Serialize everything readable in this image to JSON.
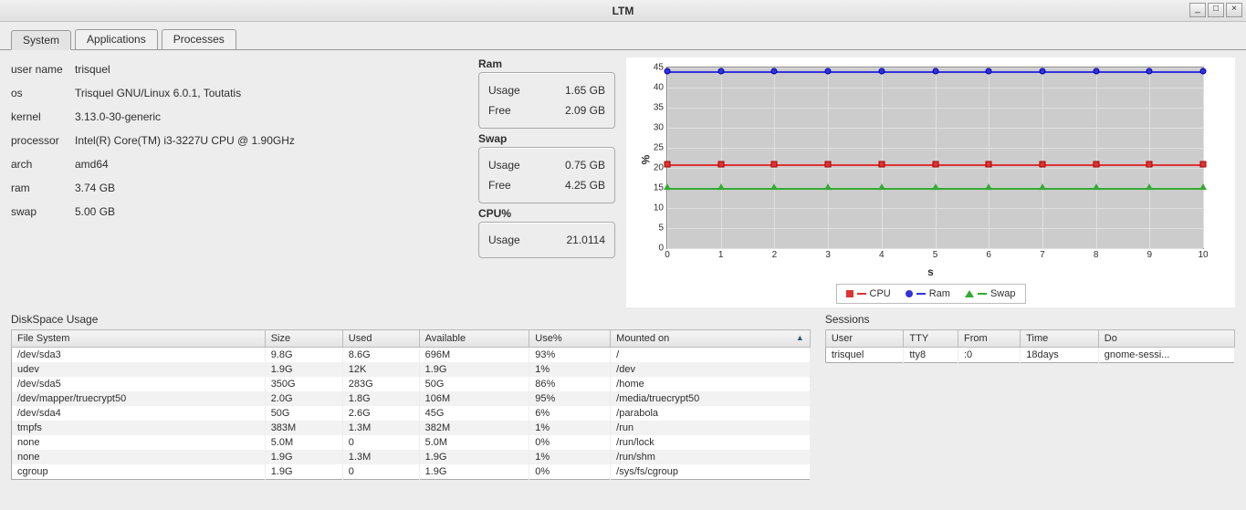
{
  "window": {
    "title": "LTM"
  },
  "tabs": [
    {
      "label": "System",
      "active": true
    },
    {
      "label": "Applications",
      "active": false
    },
    {
      "label": "Processes",
      "active": false
    }
  ],
  "sysinfo": [
    {
      "label": "user name",
      "value": "trisquel"
    },
    {
      "label": "os",
      "value": "Trisquel GNU/Linux 6.0.1, Toutatis"
    },
    {
      "label": "kernel",
      "value": "3.13.0-30-generic"
    },
    {
      "label": "processor",
      "value": "Intel(R) Core(TM) i3-3227U CPU @ 1.90GHz"
    },
    {
      "label": "arch",
      "value": "amd64"
    },
    {
      "label": "ram",
      "value": "3.74 GB"
    },
    {
      "label": "swap",
      "value": "5.00 GB"
    }
  ],
  "metrics": {
    "ram": {
      "title": "Ram",
      "usage_label": "Usage",
      "usage": "1.65 GB",
      "free_label": "Free",
      "free": "2.09 GB"
    },
    "swap": {
      "title": "Swap",
      "usage_label": "Usage",
      "usage": "0.75 GB",
      "free_label": "Free",
      "free": "4.25 GB"
    },
    "cpu": {
      "title": "CPU%",
      "usage_label": "Usage",
      "usage": "21.0114"
    }
  },
  "chart_data": {
    "type": "line",
    "xlabel": "s",
    "ylabel": "%",
    "x": [
      0,
      1,
      2,
      3,
      4,
      5,
      6,
      7,
      8,
      9,
      10
    ],
    "ylim": [
      0,
      45
    ],
    "y_ticks": [
      0,
      5,
      10,
      15,
      20,
      25,
      30,
      35,
      40,
      45
    ],
    "series": [
      {
        "name": "CPU",
        "color": "#d33",
        "marker": "square",
        "values": [
          21,
          21,
          21,
          21,
          21,
          21,
          21,
          21,
          21,
          21,
          21
        ]
      },
      {
        "name": "Ram",
        "color": "#33d",
        "marker": "circle",
        "values": [
          44,
          44,
          44,
          44,
          44,
          44,
          44,
          44,
          44,
          44,
          44
        ]
      },
      {
        "name": "Swap",
        "color": "#3a3",
        "marker": "triangle",
        "values": [
          15,
          15,
          15,
          15,
          15,
          15,
          15,
          15,
          15,
          15,
          15
        ]
      }
    ],
    "legend": [
      "CPU",
      "Ram",
      "Swap"
    ]
  },
  "disk": {
    "title": "DiskSpace Usage",
    "columns": [
      "File System",
      "Size",
      "Used",
      "Available",
      "Use%",
      "Mounted on"
    ],
    "sort_col": 5,
    "rows": [
      [
        "/dev/sda3",
        "9.8G",
        "8.6G",
        "696M",
        "93%",
        "/"
      ],
      [
        "udev",
        "1.9G",
        "12K",
        "1.9G",
        "1%",
        "/dev"
      ],
      [
        "/dev/sda5",
        "350G",
        "283G",
        "50G",
        "86%",
        "/home"
      ],
      [
        "/dev/mapper/truecrypt50",
        "2.0G",
        "1.8G",
        "106M",
        "95%",
        "/media/truecrypt50"
      ],
      [
        "/dev/sda4",
        "50G",
        "2.6G",
        "45G",
        "6%",
        "/parabola"
      ],
      [
        "tmpfs",
        "383M",
        "1.3M",
        "382M",
        "1%",
        "/run"
      ],
      [
        "none",
        "5.0M",
        "0",
        "5.0M",
        "0%",
        "/run/lock"
      ],
      [
        "none",
        "1.9G",
        "1.3M",
        "1.9G",
        "1%",
        "/run/shm"
      ],
      [
        "cgroup",
        "1.9G",
        "0",
        "1.9G",
        "0%",
        "/sys/fs/cgroup"
      ]
    ]
  },
  "sessions": {
    "title": "Sessions",
    "columns": [
      "User",
      "TTY",
      "From",
      "Time",
      "Do"
    ],
    "rows": [
      [
        "trisquel",
        "tty8",
        ":0",
        "18days",
        "gnome-sessi..."
      ]
    ]
  }
}
